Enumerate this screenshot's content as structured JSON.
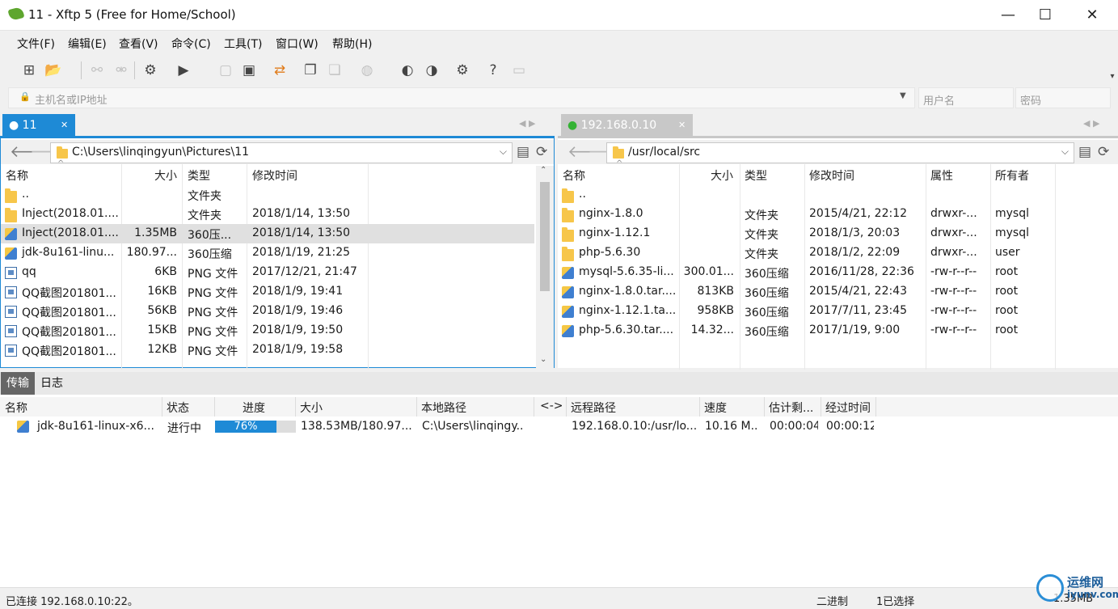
{
  "window": {
    "title": "11 - Xftp 5 (Free for Home/School)",
    "min_glyph": "—",
    "max_glyph": "☐",
    "close_glyph": "✕"
  },
  "menu": [
    "文件(F)",
    "编辑(E)",
    "查看(V)",
    "命令(C)",
    "工具(T)",
    "窗口(W)",
    "帮助(H)"
  ],
  "address": {
    "placeholder": "主机名或IP地址",
    "user_placeholder": "用户名",
    "password_placeholder": "密码"
  },
  "left": {
    "tab": "● 11",
    "path": "C:\\Users\\linqingyun\\Pictures\\11",
    "columns": [
      "名称",
      "大小",
      "类型",
      "修改时间"
    ],
    "rows": [
      {
        "icon": "folder",
        "name": "..",
        "size": "",
        "type": "文件夹",
        "mtime": ""
      },
      {
        "icon": "folder",
        "name": "Inject(2018.01....",
        "size": "",
        "type": "文件夹",
        "mtime": "2018/1/14, 13:50"
      },
      {
        "icon": "archive",
        "name": "Inject(2018.01....",
        "size": "1.35MB",
        "type": "360压...",
        "mtime": "2018/1/14, 13:50"
      },
      {
        "icon": "archive",
        "name": "jdk-8u161-linu...",
        "size": "180.97...",
        "type": "360压缩",
        "mtime": "2018/1/19, 21:25"
      },
      {
        "icon": "file",
        "name": "qq",
        "size": "6KB",
        "type": "PNG 文件",
        "mtime": "2017/12/21, 21:47"
      },
      {
        "icon": "file",
        "name": "QQ截图201801...",
        "size": "16KB",
        "type": "PNG 文件",
        "mtime": "2018/1/9, 19:41"
      },
      {
        "icon": "file",
        "name": "QQ截图201801...",
        "size": "56KB",
        "type": "PNG 文件",
        "mtime": "2018/1/9, 19:46"
      },
      {
        "icon": "file",
        "name": "QQ截图201801...",
        "size": "15KB",
        "type": "PNG 文件",
        "mtime": "2018/1/9, 19:50"
      },
      {
        "icon": "file",
        "name": "QQ截图201801...",
        "size": "12KB",
        "type": "PNG 文件",
        "mtime": "2018/1/9, 19:58"
      }
    ]
  },
  "right": {
    "tab": "192.168.0.10",
    "path": "/usr/local/src",
    "columns": [
      "名称",
      "大小",
      "类型",
      "修改时间",
      "属性",
      "所有者"
    ],
    "rows": [
      {
        "icon": "folder",
        "name": "..",
        "size": "",
        "type": "",
        "mtime": "",
        "attr": "",
        "owner": ""
      },
      {
        "icon": "folder",
        "name": "nginx-1.8.0",
        "size": "",
        "type": "文件夹",
        "mtime": "2015/4/21, 22:12",
        "attr": "drwxr-...",
        "owner": "mysql"
      },
      {
        "icon": "folder",
        "name": "nginx-1.12.1",
        "size": "",
        "type": "文件夹",
        "mtime": "2018/1/3, 20:03",
        "attr": "drwxr-...",
        "owner": "mysql"
      },
      {
        "icon": "folder",
        "name": "php-5.6.30",
        "size": "",
        "type": "文件夹",
        "mtime": "2018/1/2, 22:09",
        "attr": "drwxr-...",
        "owner": "user"
      },
      {
        "icon": "archive",
        "name": "mysql-5.6.35-li...",
        "size": "300.01...",
        "type": "360压缩",
        "mtime": "2016/11/28, 22:36",
        "attr": "-rw-r--r--",
        "owner": "root"
      },
      {
        "icon": "archive",
        "name": "nginx-1.8.0.tar....",
        "size": "813KB",
        "type": "360压缩",
        "mtime": "2015/4/21, 22:43",
        "attr": "-rw-r--r--",
        "owner": "root"
      },
      {
        "icon": "archive",
        "name": "nginx-1.12.1.ta...",
        "size": "958KB",
        "type": "360压缩",
        "mtime": "2017/7/11, 23:45",
        "attr": "-rw-r--r--",
        "owner": "root"
      },
      {
        "icon": "archive",
        "name": "php-5.6.30.tar....",
        "size": "14.32...",
        "type": "360压缩",
        "mtime": "2017/1/19, 9:00",
        "attr": "-rw-r--r--",
        "owner": "root"
      }
    ]
  },
  "transfer": {
    "tabs": [
      "传输",
      "日志"
    ],
    "columns": [
      "名称",
      "状态",
      "进度",
      "大小",
      "本地路径",
      "<->",
      "远程路径",
      "速度",
      "估计剩...",
      "经过时间"
    ],
    "row": {
      "name": "jdk-8u161-linux-x6...",
      "status": "进行中",
      "progress": 76,
      "progress_label": "76%",
      "size": "138.53MB/180.97...",
      "local": "C:\\Users\\linqingy..",
      "remote": "192.168.0.10:/usr/lo...",
      "speed": "10.16 M..",
      "eta": "00:00:04",
      "elapsed": "00:00:12"
    }
  },
  "status": {
    "connected": "已连接 192.168.0.10:22。",
    "mode": "二进制",
    "selected": "1已选择",
    "size": "1.35MB"
  },
  "watermark": {
    "cn": "运维网",
    "en": "iyunv.com"
  }
}
